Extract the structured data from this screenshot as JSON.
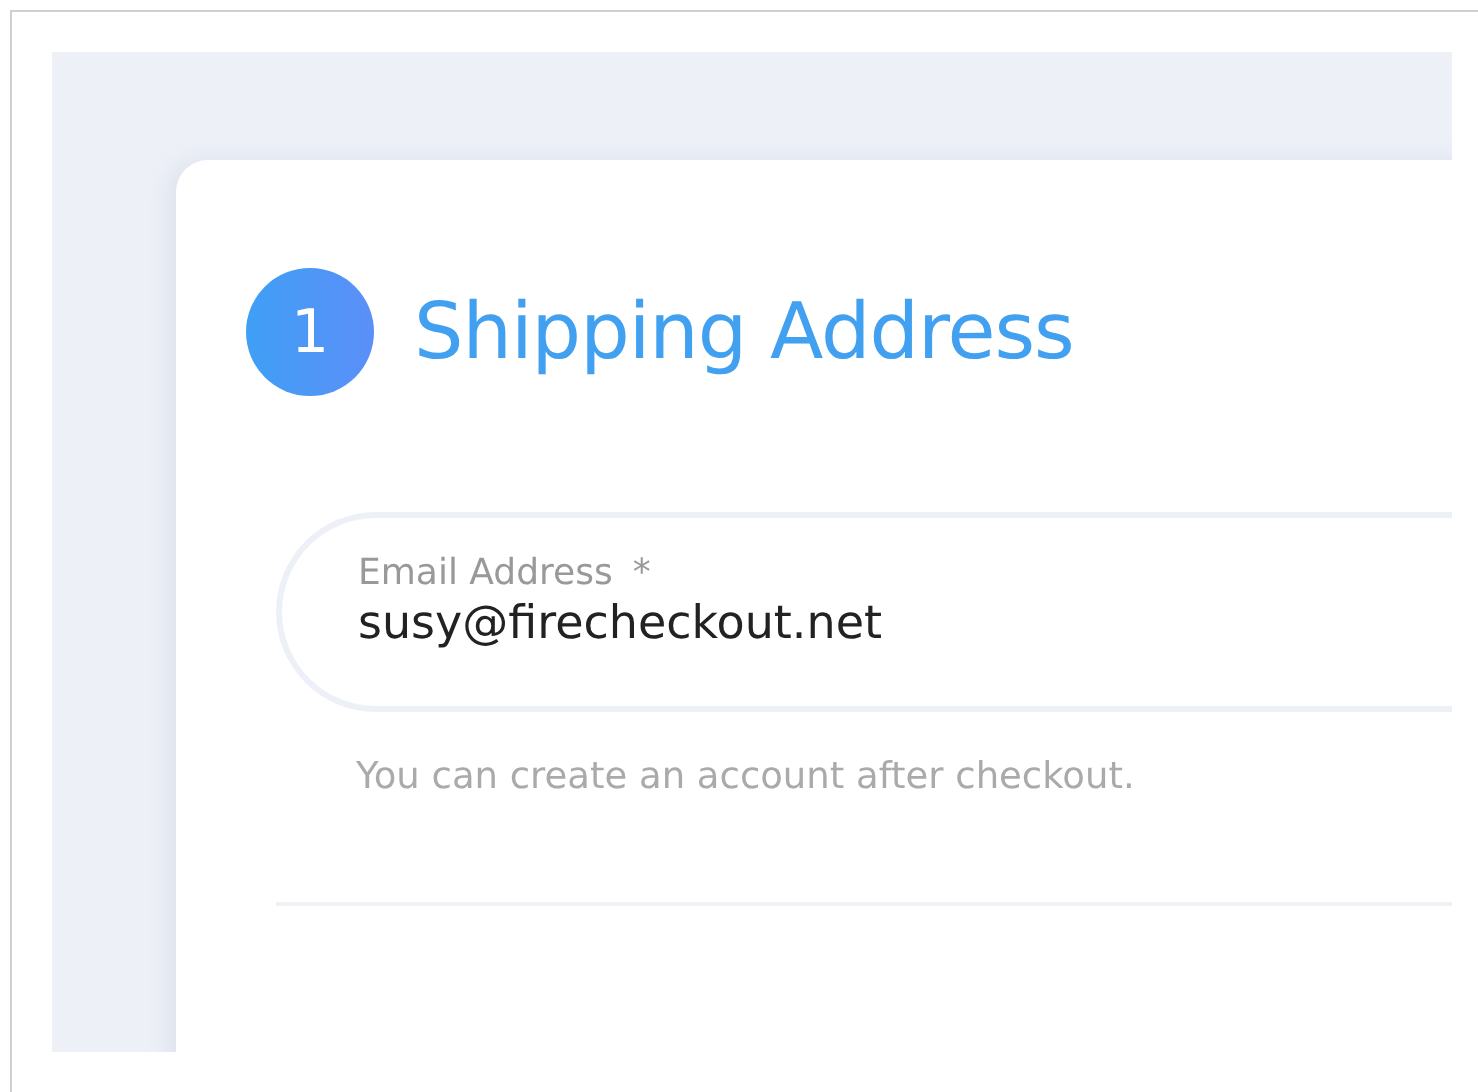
{
  "section": {
    "step": "1",
    "title": "Shipping Address"
  },
  "email_field": {
    "label": "Email Address",
    "required_mark": "*",
    "value": "susy@firecheckout.net",
    "hint": "You can create an account after checkout."
  }
}
